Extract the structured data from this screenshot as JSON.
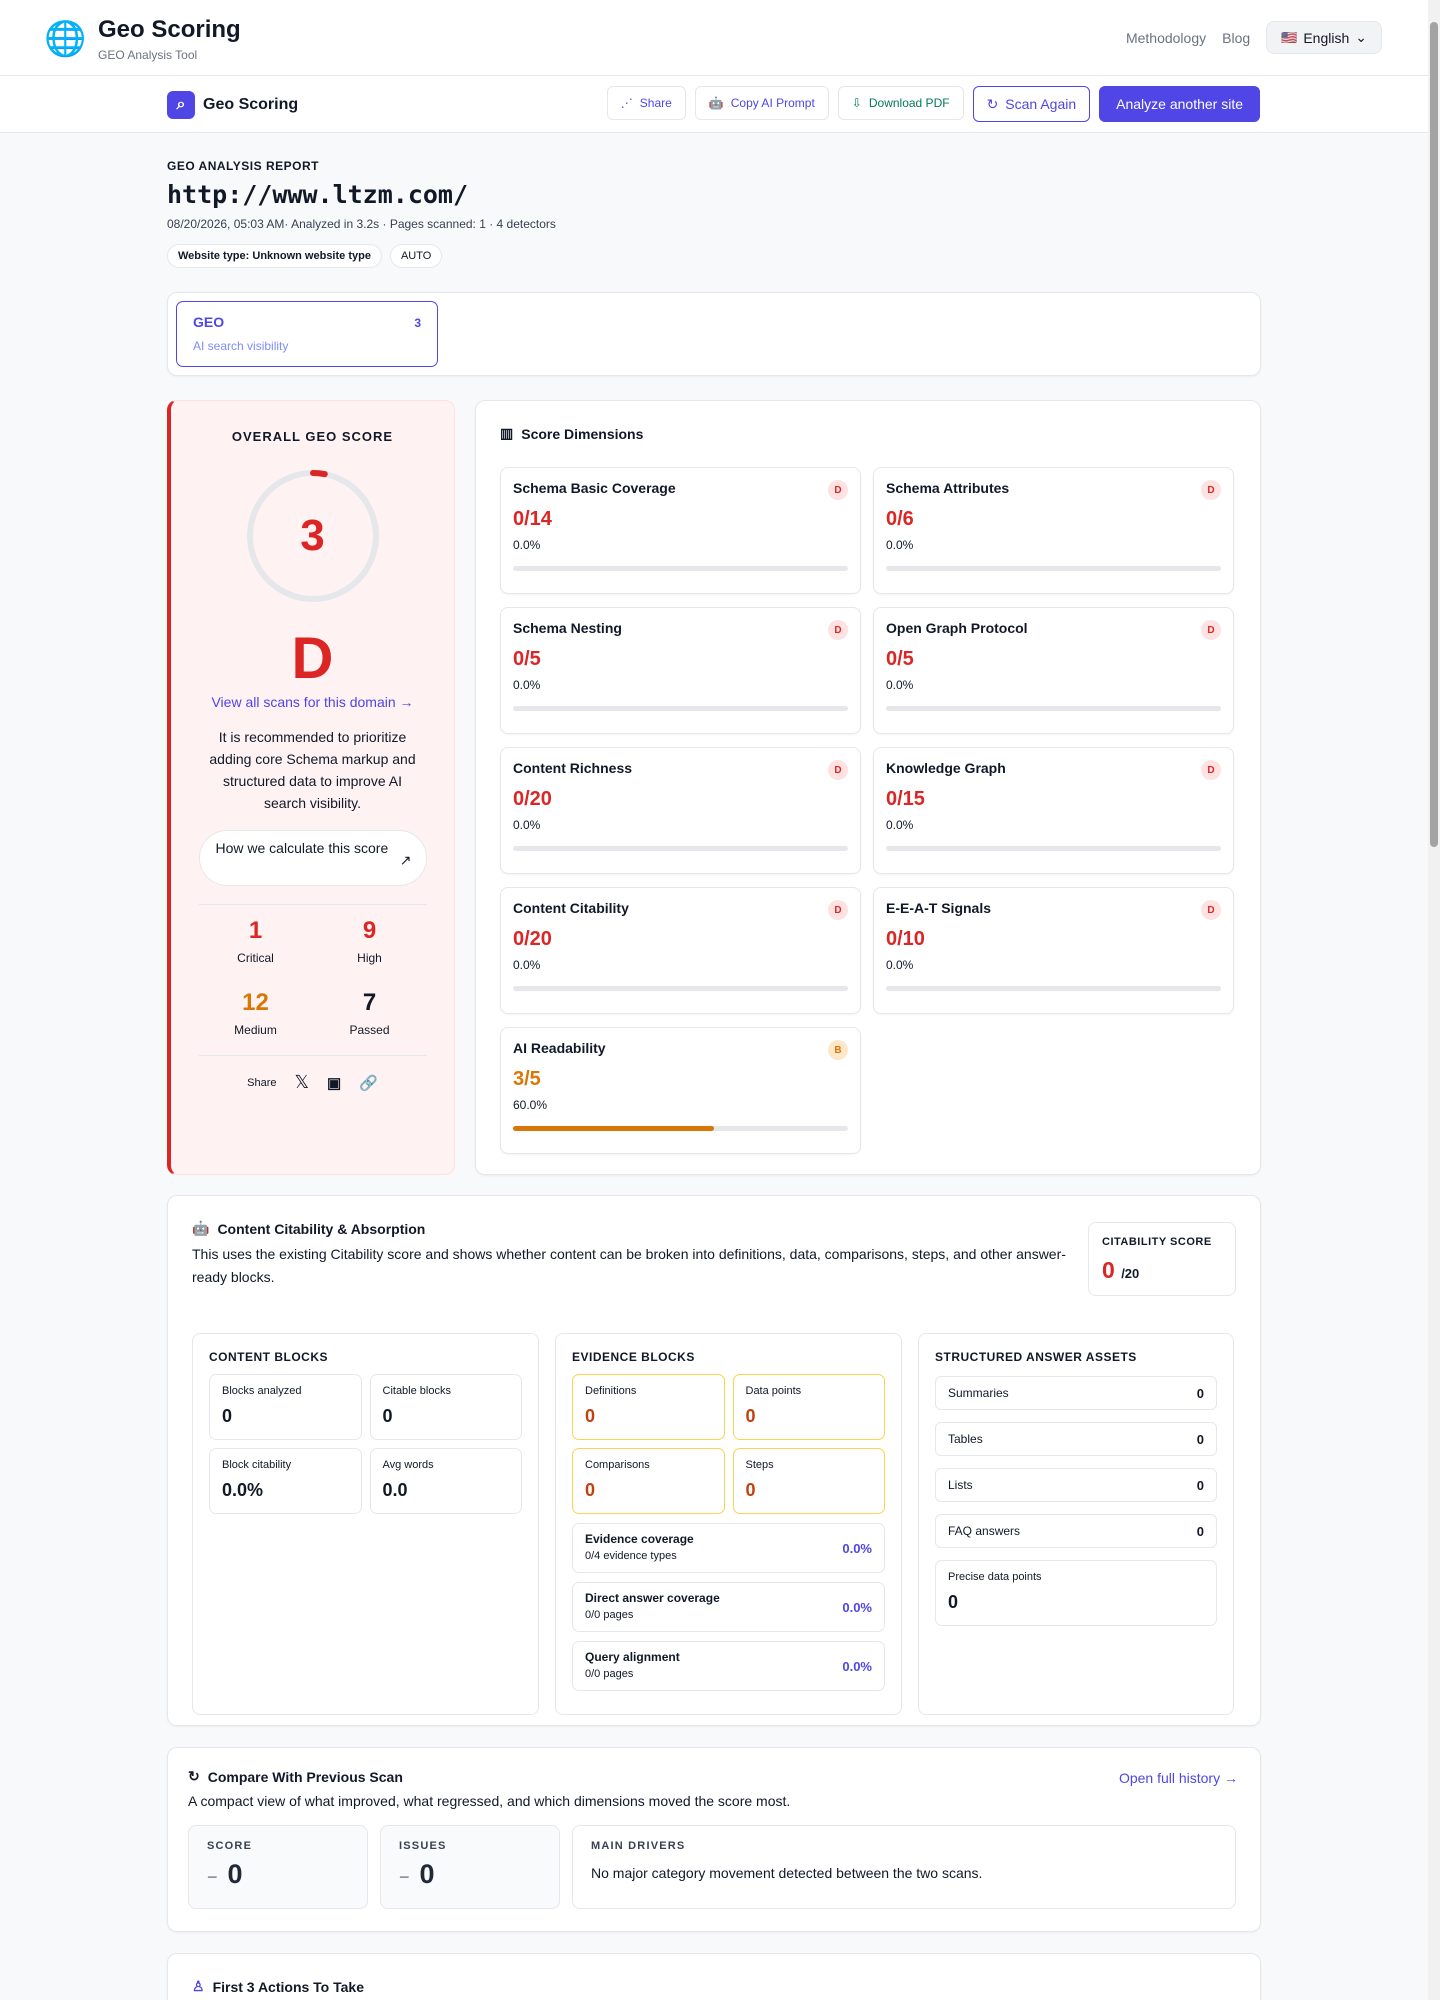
{
  "app": {
    "title": "Geo Scoring",
    "subtitle": "GEO Analysis Tool"
  },
  "nav": {
    "methodology": "Methodology",
    "blog": "Blog",
    "language": "English",
    "flag": "🇺🇸"
  },
  "toolbar": {
    "title": "Geo Scoring",
    "share": "Share",
    "copy_prompt": "Copy AI Prompt",
    "download_pdf": "Download PDF",
    "scan_again": "Scan Again",
    "analyze_another": "Analyze another site"
  },
  "report": {
    "label": "GEO ANALYSIS REPORT",
    "url": "http://www.ltzm.com/",
    "meta": "08/20/2026, 05:03 AM· Analyzed in 3.2s · Pages scanned: 1 · 4 detectors",
    "website_type_label": "Website type:",
    "website_type": "Unknown website type",
    "mode": "AUTO"
  },
  "tab": {
    "title": "GEO",
    "count": "3",
    "subtitle": "AI search visibility"
  },
  "overall": {
    "title": "OVERALL GEO SCORE",
    "score": "3",
    "score_fraction": 0.03,
    "grade": "D",
    "view_scans": "View all scans for this domain →",
    "recommendation": "It is recommended to prioritize adding core Schema markup and structured data to improve AI search visibility.",
    "calculate": "How we calculate this score",
    "stats": [
      {
        "value": "1",
        "label": "Critical",
        "color": "#dc2626"
      },
      {
        "value": "9",
        "label": "High",
        "color": "#dc2626"
      },
      {
        "value": "12",
        "label": "Medium",
        "color": "#d97706"
      },
      {
        "value": "7",
        "label": "Passed",
        "color": "#111827"
      }
    ],
    "share": "Share"
  },
  "dimensions": {
    "title": "Score Dimensions",
    "items": [
      {
        "name": "Schema Basic Coverage",
        "grade": "D",
        "score": "0/14",
        "percent": "0.0%",
        "fraction": 0
      },
      {
        "name": "Schema Attributes",
        "grade": "D",
        "score": "0/6",
        "percent": "0.0%",
        "fraction": 0
      },
      {
        "name": "Schema Nesting",
        "grade": "D",
        "score": "0/5",
        "percent": "0.0%",
        "fraction": 0
      },
      {
        "name": "Open Graph Protocol",
        "grade": "D",
        "score": "0/5",
        "percent": "0.0%",
        "fraction": 0
      },
      {
        "name": "Content Richness",
        "grade": "D",
        "score": "0/20",
        "percent": "0.0%",
        "fraction": 0
      },
      {
        "name": "Knowledge Graph",
        "grade": "D",
        "score": "0/15",
        "percent": "0.0%",
        "fraction": 0
      },
      {
        "name": "Content Citability",
        "grade": "D",
        "score": "0/20",
        "percent": "0.0%",
        "fraction": 0
      },
      {
        "name": "E-E-A-T Signals",
        "grade": "D",
        "score": "0/10",
        "percent": "0.0%",
        "fraction": 0
      },
      {
        "name": "AI Readability",
        "grade": "B",
        "score": "3/5",
        "percent": "60.0%",
        "fraction": 0.6
      }
    ]
  },
  "citability": {
    "title": "Content Citability & Absorption",
    "description": "This uses the existing Citability score and shows whether content can be broken into definitions, data, comparisons, steps, and other answer-ready blocks.",
    "score_label": "CITABILITY SCORE",
    "score": "0",
    "score_total": "/20",
    "content_blocks": {
      "title": "CONTENT BLOCKS",
      "items": [
        {
          "label": "Blocks analyzed",
          "value": "0"
        },
        {
          "label": "Citable blocks",
          "value": "0"
        },
        {
          "label": "Block citability",
          "value": "0.0%"
        },
        {
          "label": "Avg words",
          "value": "0.0"
        }
      ]
    },
    "evidence_blocks": {
      "title": "EVIDENCE BLOCKS",
      "items": [
        {
          "label": "Definitions",
          "value": "0"
        },
        {
          "label": "Data points",
          "value": "0"
        },
        {
          "label": "Comparisons",
          "value": "0"
        },
        {
          "label": "Steps",
          "value": "0"
        }
      ],
      "coverage": [
        {
          "title": "Evidence coverage",
          "subtitle": "0/4 evidence types",
          "value": "0.0%"
        },
        {
          "title": "Direct answer coverage",
          "subtitle": "0/0 pages",
          "value": "0.0%"
        },
        {
          "title": "Query alignment",
          "subtitle": "0/0 pages",
          "value": "0.0%"
        }
      ]
    },
    "structured_assets": {
      "title": "STRUCTURED ANSWER ASSETS",
      "items": [
        {
          "label": "Summaries",
          "value": "0"
        },
        {
          "label": "Tables",
          "value": "0"
        },
        {
          "label": "Lists",
          "value": "0"
        },
        {
          "label": "FAQ answers",
          "value": "0"
        }
      ],
      "precise_label": "Precise data points",
      "precise_value": "0"
    }
  },
  "compare": {
    "title": "Compare With Previous Scan",
    "history": "Open full history →",
    "description": "A compact view of what improved, what regressed, and which dimensions moved the score most.",
    "score_label": "SCORE",
    "score_change": "−",
    "score_value": "0",
    "issues_label": "ISSUES",
    "issues_change": "−",
    "issues_value": "0",
    "drivers_label": "MAIN DRIVERS",
    "drivers_text": "No major category movement detected between the two scans."
  },
  "actions": {
    "title": "First 3 Actions To Take"
  }
}
